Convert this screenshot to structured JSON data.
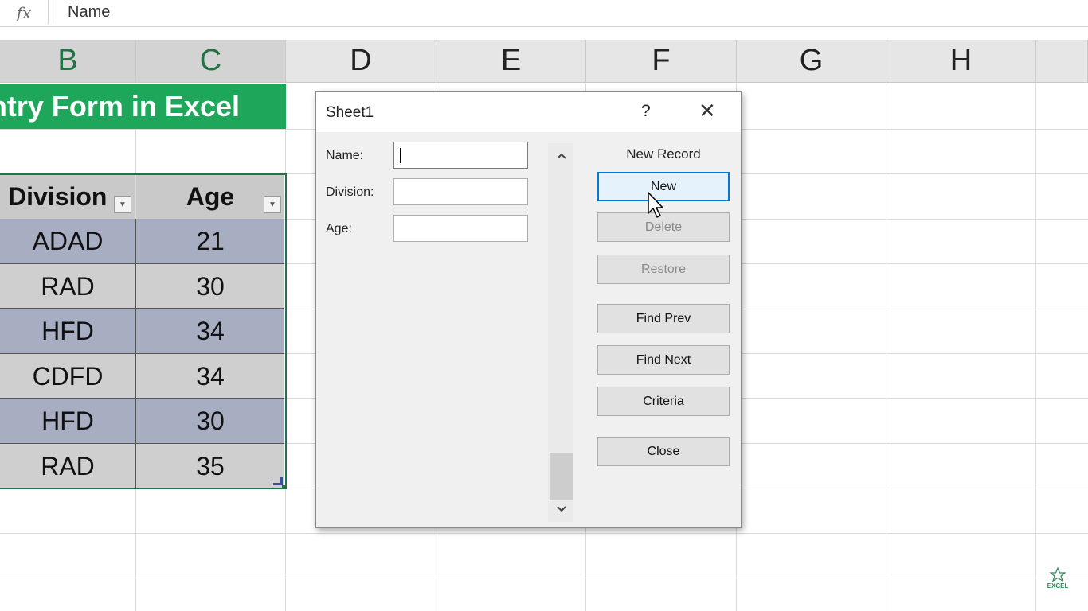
{
  "formula_bar": {
    "fx_label": "fx",
    "content": "Name"
  },
  "columns": [
    "B",
    "C",
    "D",
    "E",
    "F",
    "G",
    "H"
  ],
  "title_banner": "ntry Form in Excel",
  "table": {
    "headers": [
      "Division",
      "Age"
    ],
    "rows": [
      {
        "division": "ADAD",
        "age": "21"
      },
      {
        "division": "RAD",
        "age": "30"
      },
      {
        "division": "HFD",
        "age": "34"
      },
      {
        "division": "CDFD",
        "age": "34"
      },
      {
        "division": "HFD",
        "age": "30"
      },
      {
        "division": "RAD",
        "age": "35"
      }
    ]
  },
  "dialog": {
    "title": "Sheet1",
    "help": "?",
    "close_glyph": "✕",
    "fields": [
      {
        "label": "Name:",
        "value": ""
      },
      {
        "label": "Division:",
        "value": ""
      },
      {
        "label": "Age:",
        "value": ""
      }
    ],
    "record_status": "New Record",
    "buttons": {
      "new": "New",
      "delete": "Delete",
      "restore": "Restore",
      "find_prev": "Find Prev",
      "find_next": "Find Next",
      "criteria": "Criteria",
      "close": "Close"
    }
  },
  "logo": {
    "text": "EXCEL"
  },
  "colors": {
    "banner": "#1ea75b",
    "row_a": "#a8aec2",
    "row_b": "#cfcfcf",
    "focus": "#0078d7"
  }
}
